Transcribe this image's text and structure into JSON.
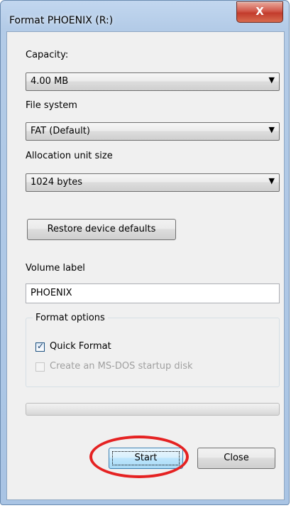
{
  "window": {
    "title": "Format PHOENIX (R:)",
    "close_glyph": "X"
  },
  "capacity": {
    "label": "Capacity:",
    "value": "4.00 MB"
  },
  "file_system": {
    "label": "File system",
    "value": "FAT (Default)"
  },
  "allocation": {
    "label": "Allocation unit size",
    "value": "1024 bytes"
  },
  "restore_button": "Restore device defaults",
  "volume": {
    "label": "Volume label",
    "value": "PHOENIX"
  },
  "format_options": {
    "title": "Format options",
    "quick_format": {
      "label": "Quick Format",
      "checked": true
    },
    "msdos_disk": {
      "label": "Create an MS-DOS startup disk",
      "checked": false,
      "enabled": false
    }
  },
  "progress": {
    "value": 0
  },
  "buttons": {
    "start": "Start",
    "close": "Close"
  },
  "highlight_color": "#e52222"
}
